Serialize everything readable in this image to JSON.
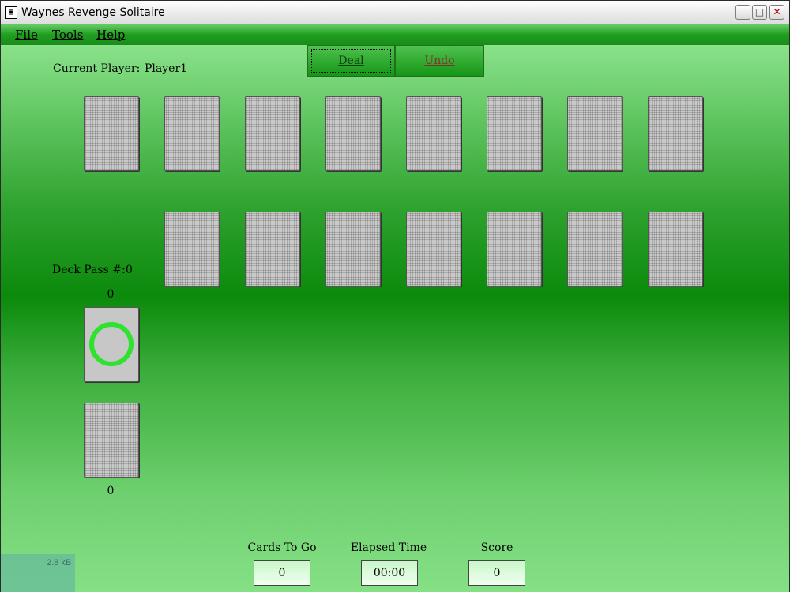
{
  "window": {
    "title": "Waynes Revenge Solitaire",
    "controls": {
      "minimize": "_",
      "maximize": "□",
      "close": "✕"
    }
  },
  "menu": {
    "file": "File",
    "tools": "Tools",
    "help": "Help"
  },
  "player": {
    "label": "Current Player:",
    "name": "Player1"
  },
  "buttons": {
    "deal": "Deal",
    "undo": "Undo"
  },
  "deck": {
    "pass_label": "Deck Pass #:",
    "pass_value": "0",
    "stock_count": "0",
    "waste_count": "0"
  },
  "stats": {
    "cards_to_go_label": "Cards To Go",
    "cards_to_go_value": "0",
    "elapsed_label": "Elapsed Time",
    "elapsed_value": "00:00",
    "score_label": "Score",
    "score_value": "0"
  },
  "overlay": {
    "text": "2.8 kB"
  },
  "colors": {
    "menu_green": "#1f9e1f",
    "table_green": "#0b8a0b",
    "ring_green": "#2fe22f"
  }
}
